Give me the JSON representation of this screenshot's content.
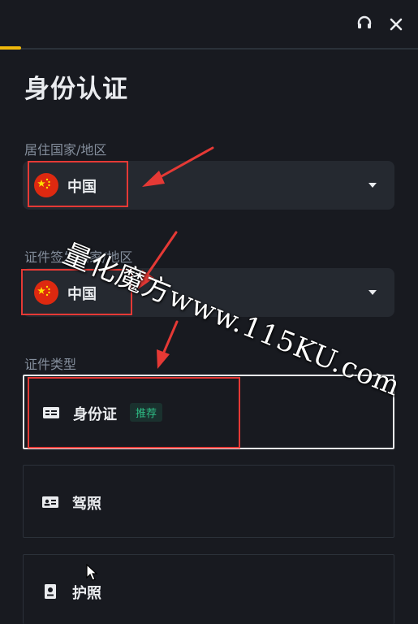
{
  "header": {
    "support_icon": "headset-icon",
    "close_icon": "close-icon"
  },
  "progress": {
    "value": 0.05,
    "color": "#F0B90B"
  },
  "page": {
    "title": "身份认证"
  },
  "residence": {
    "label": "居住国家/地区",
    "value": "中国",
    "flag_icon": "china-flag-icon"
  },
  "issuing": {
    "label": "证件签发国家/地区",
    "value": "中国",
    "flag_icon": "china-flag-icon"
  },
  "doc_type": {
    "label": "证件类型",
    "options": [
      {
        "label": "身份证",
        "badge": "推荐",
        "icon": "id-card-icon",
        "selected": true
      },
      {
        "label": "驾照",
        "icon": "driver-license-icon",
        "selected": false
      },
      {
        "label": "护照",
        "icon": "passport-icon",
        "selected": false
      }
    ]
  },
  "watermark": {
    "text": "量化魔方www.115KU.com"
  },
  "colors": {
    "background": "#181A20",
    "field": "#252930",
    "accent": "#F0B90B",
    "badge": "#2EBD85",
    "annotation": "#E53935"
  }
}
